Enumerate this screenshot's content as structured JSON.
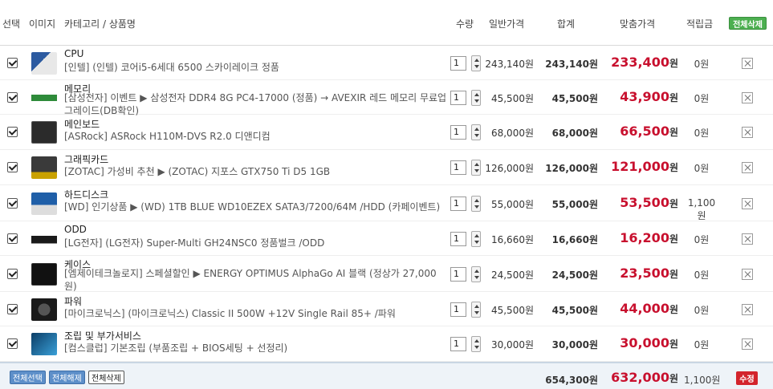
{
  "header": {
    "select": "선택",
    "image": "이미지",
    "category_name": "카테고리 / 상품명",
    "qty": "수량",
    "price": "일반가격",
    "total": "합계",
    "custom": "맞춤가격",
    "point": "적립금",
    "delete_all": "전체삭제"
  },
  "won": "원",
  "items": [
    {
      "category": "CPU",
      "product": "[인텔] (인텔) 코어i5-6세대 6500 스카이레이크 정품",
      "qty": "1",
      "price": "243,140원",
      "total": "243,140원",
      "custom": "233,400",
      "point": "0원",
      "icon": "cpu-box-icon"
    },
    {
      "category": "메모리",
      "product": "[삼성전자] 이벤트 ▶ 삼성전자 DDR4 8G PC4-17000 (정품) → AVEXIR 레드 메모리 무료업그레이드(DB확인)",
      "qty": "1",
      "price": "45,500원",
      "total": "45,500원",
      "custom": "43,900",
      "point": "0원",
      "icon": "memory-stick-icon"
    },
    {
      "category": "메인보드",
      "product": "[ASRock] ASRock H110M-DVS R2.0 디앤디컴",
      "qty": "1",
      "price": "68,000원",
      "total": "68,000원",
      "custom": "66,500",
      "point": "0원",
      "icon": "motherboard-icon"
    },
    {
      "category": "그래픽카드",
      "product": "[ZOTAC] 가성비 추천 ▶ (ZOTAC) 지포스 GTX750 Ti D5 1GB",
      "qty": "1",
      "price": "126,000원",
      "total": "126,000원",
      "custom": "121,000",
      "point": "0원",
      "icon": "graphics-card-icon"
    },
    {
      "category": "하드디스크",
      "product": "[WD] 인기상품 ▶ (WD) 1TB BLUE WD10EZEX SATA3/7200/64M /HDD (카페이벤트)",
      "qty": "1",
      "price": "55,000원",
      "total": "55,000원",
      "custom": "53,500",
      "point": "1,100원",
      "icon": "hard-disk-icon"
    },
    {
      "category": "ODD",
      "product": "[LG전자] (LG전자) Super-Multi GH24NSC0 정품벌크 /ODD",
      "qty": "1",
      "price": "16,660원",
      "total": "16,660원",
      "custom": "16,200",
      "point": "0원",
      "icon": "optical-drive-icon"
    },
    {
      "category": "케이스",
      "product": "[엠제이테크놀로지] 스페셜할인 ▶ ENERGY OPTIMUS AlphaGo AI 블랙 (정상가 27,000원)",
      "qty": "1",
      "price": "24,500원",
      "total": "24,500원",
      "custom": "23,500",
      "point": "0원",
      "icon": "pc-case-icon"
    },
    {
      "category": "파워",
      "product": "[마이크로닉스] (마이크로닉스) Classic II 500W +12V Single Rail 85+ /파워",
      "qty": "1",
      "price": "45,500원",
      "total": "45,500원",
      "custom": "44,000",
      "point": "0원",
      "icon": "power-supply-icon"
    },
    {
      "category": "조립 및 부가서비스",
      "product": "[컴스클럽] 기본조립 (부품조립 + BIOS세팅 + 선정리)",
      "qty": "1",
      "price": "30,000원",
      "total": "30,000원",
      "custom": "30,000",
      "point": "0원",
      "icon": "assembly-service-icon"
    }
  ],
  "footer": {
    "select_all": "전체선택",
    "deselect_all": "전체해제",
    "delete_all": "전체삭제",
    "sum_total": "654,300원",
    "sum_custom": "632,000",
    "sum_point": "1,100원",
    "modify": "수정"
  },
  "colors": {
    "custom_price": "#c8102e",
    "delete_all_top": "#4caf50",
    "modify_button": "#d3242c",
    "footer_button": "#5d8fc9"
  }
}
